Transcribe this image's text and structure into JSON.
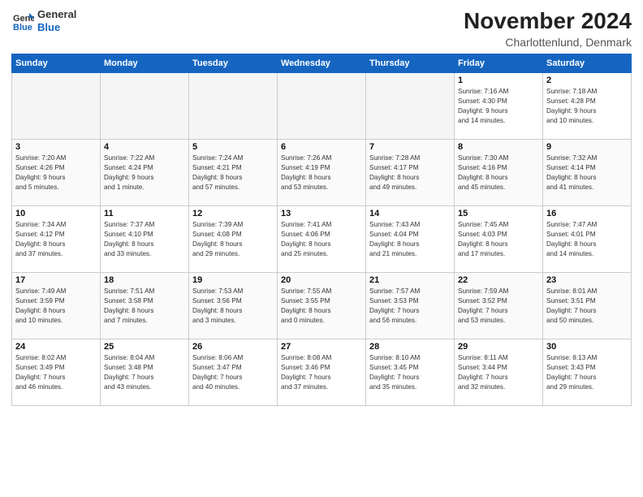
{
  "logo": {
    "general": "General",
    "blue": "Blue"
  },
  "title": "November 2024",
  "location": "Charlottenlund, Denmark",
  "days_of_week": [
    "Sunday",
    "Monday",
    "Tuesday",
    "Wednesday",
    "Thursday",
    "Friday",
    "Saturday"
  ],
  "weeks": [
    [
      {
        "day": "",
        "info": ""
      },
      {
        "day": "",
        "info": ""
      },
      {
        "day": "",
        "info": ""
      },
      {
        "day": "",
        "info": ""
      },
      {
        "day": "",
        "info": ""
      },
      {
        "day": "1",
        "info": "Sunrise: 7:16 AM\nSunset: 4:30 PM\nDaylight: 9 hours\nand 14 minutes."
      },
      {
        "day": "2",
        "info": "Sunrise: 7:18 AM\nSunset: 4:28 PM\nDaylight: 9 hours\nand 10 minutes."
      }
    ],
    [
      {
        "day": "3",
        "info": "Sunrise: 7:20 AM\nSunset: 4:26 PM\nDaylight: 9 hours\nand 5 minutes."
      },
      {
        "day": "4",
        "info": "Sunrise: 7:22 AM\nSunset: 4:24 PM\nDaylight: 9 hours\nand 1 minute."
      },
      {
        "day": "5",
        "info": "Sunrise: 7:24 AM\nSunset: 4:21 PM\nDaylight: 8 hours\nand 57 minutes."
      },
      {
        "day": "6",
        "info": "Sunrise: 7:26 AM\nSunset: 4:19 PM\nDaylight: 8 hours\nand 53 minutes."
      },
      {
        "day": "7",
        "info": "Sunrise: 7:28 AM\nSunset: 4:17 PM\nDaylight: 8 hours\nand 49 minutes."
      },
      {
        "day": "8",
        "info": "Sunrise: 7:30 AM\nSunset: 4:16 PM\nDaylight: 8 hours\nand 45 minutes."
      },
      {
        "day": "9",
        "info": "Sunrise: 7:32 AM\nSunset: 4:14 PM\nDaylight: 8 hours\nand 41 minutes."
      }
    ],
    [
      {
        "day": "10",
        "info": "Sunrise: 7:34 AM\nSunset: 4:12 PM\nDaylight: 8 hours\nand 37 minutes."
      },
      {
        "day": "11",
        "info": "Sunrise: 7:37 AM\nSunset: 4:10 PM\nDaylight: 8 hours\nand 33 minutes."
      },
      {
        "day": "12",
        "info": "Sunrise: 7:39 AM\nSunset: 4:08 PM\nDaylight: 8 hours\nand 29 minutes."
      },
      {
        "day": "13",
        "info": "Sunrise: 7:41 AM\nSunset: 4:06 PM\nDaylight: 8 hours\nand 25 minutes."
      },
      {
        "day": "14",
        "info": "Sunrise: 7:43 AM\nSunset: 4:04 PM\nDaylight: 8 hours\nand 21 minutes."
      },
      {
        "day": "15",
        "info": "Sunrise: 7:45 AM\nSunset: 4:03 PM\nDaylight: 8 hours\nand 17 minutes."
      },
      {
        "day": "16",
        "info": "Sunrise: 7:47 AM\nSunset: 4:01 PM\nDaylight: 8 hours\nand 14 minutes."
      }
    ],
    [
      {
        "day": "17",
        "info": "Sunrise: 7:49 AM\nSunset: 3:59 PM\nDaylight: 8 hours\nand 10 minutes."
      },
      {
        "day": "18",
        "info": "Sunrise: 7:51 AM\nSunset: 3:58 PM\nDaylight: 8 hours\nand 7 minutes."
      },
      {
        "day": "19",
        "info": "Sunrise: 7:53 AM\nSunset: 3:56 PM\nDaylight: 8 hours\nand 3 minutes."
      },
      {
        "day": "20",
        "info": "Sunrise: 7:55 AM\nSunset: 3:55 PM\nDaylight: 8 hours\nand 0 minutes."
      },
      {
        "day": "21",
        "info": "Sunrise: 7:57 AM\nSunset: 3:53 PM\nDaylight: 7 hours\nand 56 minutes."
      },
      {
        "day": "22",
        "info": "Sunrise: 7:59 AM\nSunset: 3:52 PM\nDaylight: 7 hours\nand 53 minutes."
      },
      {
        "day": "23",
        "info": "Sunrise: 8:01 AM\nSunset: 3:51 PM\nDaylight: 7 hours\nand 50 minutes."
      }
    ],
    [
      {
        "day": "24",
        "info": "Sunrise: 8:02 AM\nSunset: 3:49 PM\nDaylight: 7 hours\nand 46 minutes."
      },
      {
        "day": "25",
        "info": "Sunrise: 8:04 AM\nSunset: 3:48 PM\nDaylight: 7 hours\nand 43 minutes."
      },
      {
        "day": "26",
        "info": "Sunrise: 8:06 AM\nSunset: 3:47 PM\nDaylight: 7 hours\nand 40 minutes."
      },
      {
        "day": "27",
        "info": "Sunrise: 8:08 AM\nSunset: 3:46 PM\nDaylight: 7 hours\nand 37 minutes."
      },
      {
        "day": "28",
        "info": "Sunrise: 8:10 AM\nSunset: 3:45 PM\nDaylight: 7 hours\nand 35 minutes."
      },
      {
        "day": "29",
        "info": "Sunrise: 8:11 AM\nSunset: 3:44 PM\nDaylight: 7 hours\nand 32 minutes."
      },
      {
        "day": "30",
        "info": "Sunrise: 8:13 AM\nSunset: 3:43 PM\nDaylight: 7 hours\nand 29 minutes."
      }
    ]
  ]
}
